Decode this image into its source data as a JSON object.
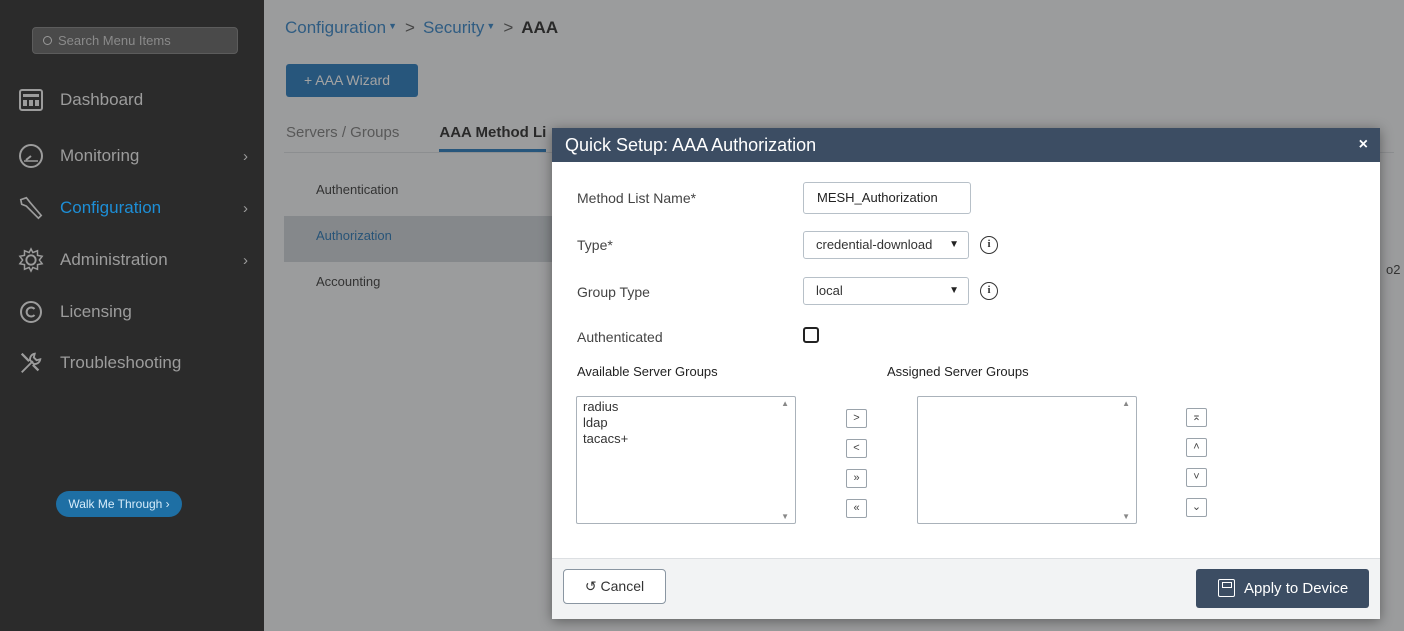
{
  "sidebar": {
    "search_placeholder": "Search Menu Items",
    "items": [
      {
        "label": "Dashboard",
        "icon": "dashboard-icon"
      },
      {
        "label": "Monitoring",
        "icon": "monitoring-icon",
        "chevron": "›"
      },
      {
        "label": "Configuration",
        "icon": "configuration-icon",
        "chevron": "›"
      },
      {
        "label": "Administration",
        "icon": "administration-icon",
        "chevron": "›"
      },
      {
        "label": "Licensing",
        "icon": "licensing-icon"
      },
      {
        "label": "Troubleshooting",
        "icon": "troubleshooting-icon"
      }
    ],
    "walk_me_through": "Walk Me Through ›"
  },
  "breadcrumb": {
    "items": [
      "Configuration",
      "Security",
      "AAA"
    ],
    "separator": ">"
  },
  "toolbar": {
    "wizard_label": "+ AAA Wizard"
  },
  "tabs": [
    "Servers / Groups",
    "AAA Method Li"
  ],
  "submenu": [
    "Authentication",
    "Authorization",
    "Accounting"
  ],
  "stray_text": "o2",
  "modal": {
    "title": "Quick Setup: AAA Authorization",
    "close": "×",
    "fields": {
      "method_list_name": {
        "label": "Method List Name*",
        "value": "MESH_Authorization"
      },
      "type": {
        "label": "Type*",
        "value": "credential-download"
      },
      "group_type": {
        "label": "Group Type",
        "value": "local"
      },
      "authenticated": {
        "label": "Authenticated",
        "checked": false
      }
    },
    "available_heading": "Available Server Groups",
    "assigned_heading": "Assigned Server Groups",
    "available_groups": [
      "radius",
      "ldap",
      "tacacs+"
    ],
    "assigned_groups": [],
    "move_buttons": [
      ">",
      "<",
      "»",
      "«"
    ],
    "order_buttons": [
      "⌅",
      "˄",
      "˅",
      "⌄"
    ],
    "cancel_label": "Cancel",
    "apply_label": "Apply to Device"
  },
  "colors": {
    "sidebar_bg": "#2b2b2b",
    "accent": "#1d8ed6",
    "modal_header": "#3c4d63"
  }
}
